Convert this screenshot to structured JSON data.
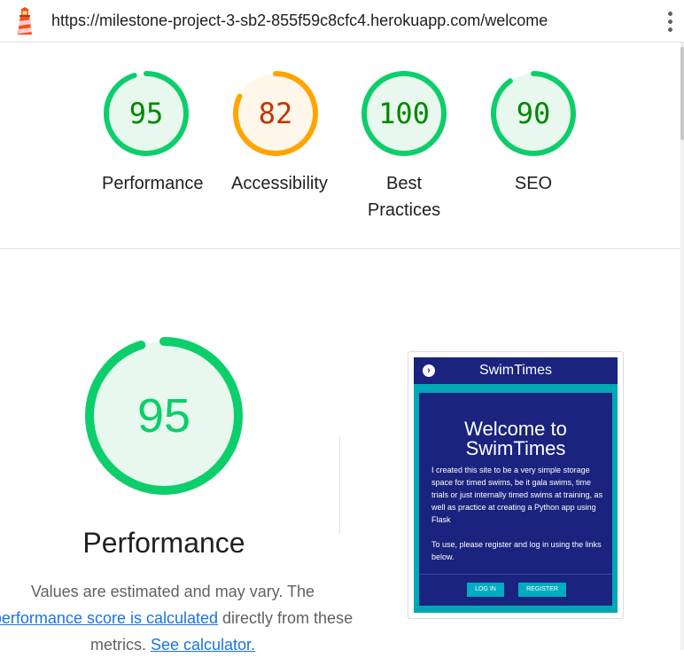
{
  "toolbar": {
    "url": "https://milestone-project-3-sb2-855f59c8cfc4.herokuapp.com/welcome",
    "logo_icon": "lighthouse-icon",
    "menu_icon": "more-vert-icon"
  },
  "colors": {
    "pass": "#0cce6b",
    "pass_text": "#008800",
    "pass_fill": "#e8f8ee",
    "average": "#ffa400",
    "average_text": "#c33300",
    "average_fill": "#fff7ea"
  },
  "scores": [
    {
      "score": 95,
      "value": "95",
      "label": "Performance",
      "status": "pass"
    },
    {
      "score": 82,
      "value": "82",
      "label": "Accessibility",
      "status": "average"
    },
    {
      "score": 100,
      "value": "100",
      "label": "Best Practices",
      "status": "pass"
    },
    {
      "score": 90,
      "value": "90",
      "label": "SEO",
      "status": "pass"
    }
  ],
  "performance": {
    "score": 95,
    "value": "95",
    "title": "Performance",
    "desc_prefix": "Values are estimated and may vary. The ",
    "link_score": "performance score is calculated",
    "desc_middle": " directly from these metrics. ",
    "link_calculator": "See calculator."
  },
  "screenshot": {
    "brand": "SwimTimes",
    "nav_icon": "chevron-right-icon",
    "heading_line1": "Welcome to",
    "heading_line2": "SwimTimes",
    "para1": "I created this site to be a very simple storage space for timed swims, be it gala swims, time trials or just internally timed swims at training, as well as practice at creating a Python app using Flask",
    "para2": "To use, please register and log in using the links below.",
    "login_label": "LOG IN",
    "register_label": "REGISTER"
  }
}
